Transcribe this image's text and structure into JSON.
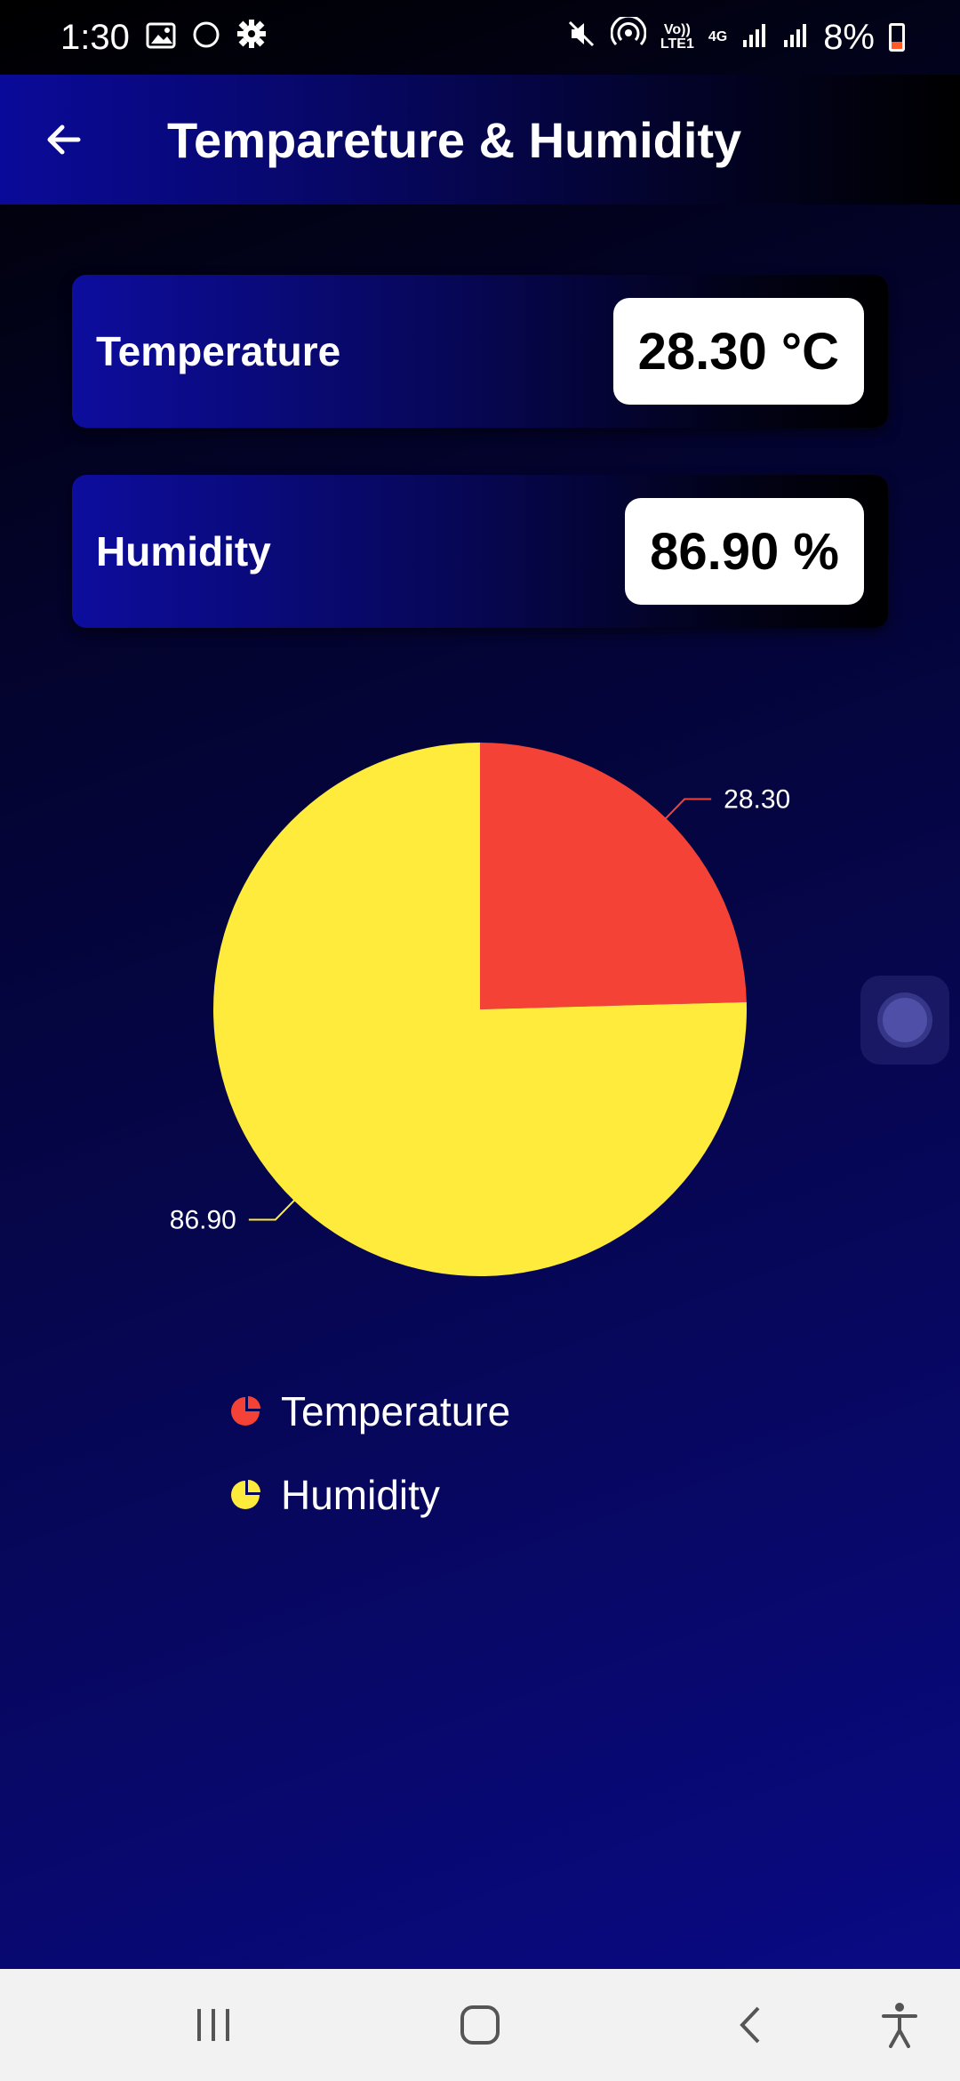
{
  "status_bar": {
    "time": "1:30",
    "network_label_top": "Vo))",
    "network_label_bottom": "LTE1",
    "network_type": "4G",
    "battery": "8%",
    "battery_color": "#ff5a2a"
  },
  "app_bar": {
    "title": "Tempareture & Humidity",
    "back_icon": "arrow-left-icon"
  },
  "cards": {
    "temperature": {
      "label": "Temperature",
      "value": "28.30 °C"
    },
    "humidity": {
      "label": "Humidity",
      "value": "86.90 %"
    }
  },
  "chart_data": {
    "type": "pie",
    "categories": [
      "Temperature",
      "Humidity"
    ],
    "values": [
      28.3,
      86.9
    ],
    "labels": [
      "28.30",
      "86.90"
    ],
    "colors": [
      "#f44336",
      "#ffeb3b"
    ],
    "legend_position": "bottom-left"
  },
  "legend": {
    "items": [
      {
        "label": "Temperature",
        "color": "#f44336"
      },
      {
        "label": "Humidity",
        "color": "#ffeb3b"
      }
    ]
  },
  "nav_bar": {
    "recent_icon": "recent-apps-icon",
    "home_icon": "home-icon",
    "back_icon": "back-icon",
    "accessibility_icon": "accessibility-icon"
  }
}
